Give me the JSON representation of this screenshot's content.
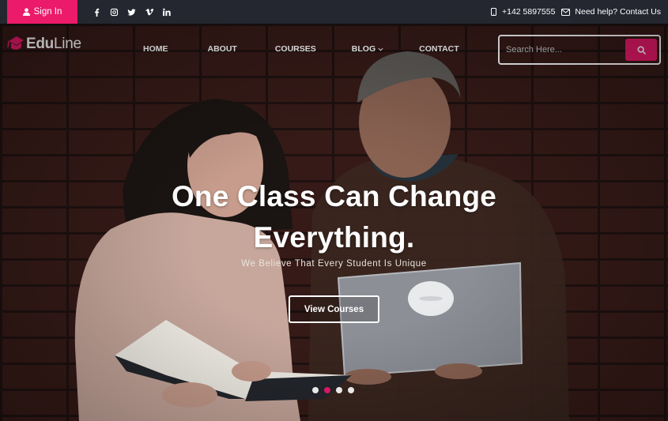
{
  "topbar": {
    "signin_label": "Sign In",
    "socials": [
      {
        "icon": "facebook-icon",
        "glyph": "f"
      },
      {
        "icon": "instagram-icon",
        "glyph": ""
      },
      {
        "icon": "twitter-icon",
        "glyph": ""
      },
      {
        "icon": "vimeo-icon",
        "glyph": "v"
      },
      {
        "icon": "linkedin-icon",
        "glyph": "in"
      }
    ],
    "phone": "+142 5897555",
    "help": "Need help? Contact Us"
  },
  "brand": {
    "logo_part1": "Edu",
    "logo_part2": "Line",
    "accent": "#ec1a6b"
  },
  "nav": {
    "items": [
      "HOME",
      "ABOUT",
      "COURSES",
      "BLOG",
      "CONTACT"
    ]
  },
  "search": {
    "placeholder": "Search Here..."
  },
  "hero": {
    "headline_line1": "One Class Can Change",
    "headline_line2": "Everything.",
    "subtext": "We Believe That Every Student Is Unique",
    "cta_label": "View Courses",
    "slide_count": 4,
    "active_slide": 2
  }
}
